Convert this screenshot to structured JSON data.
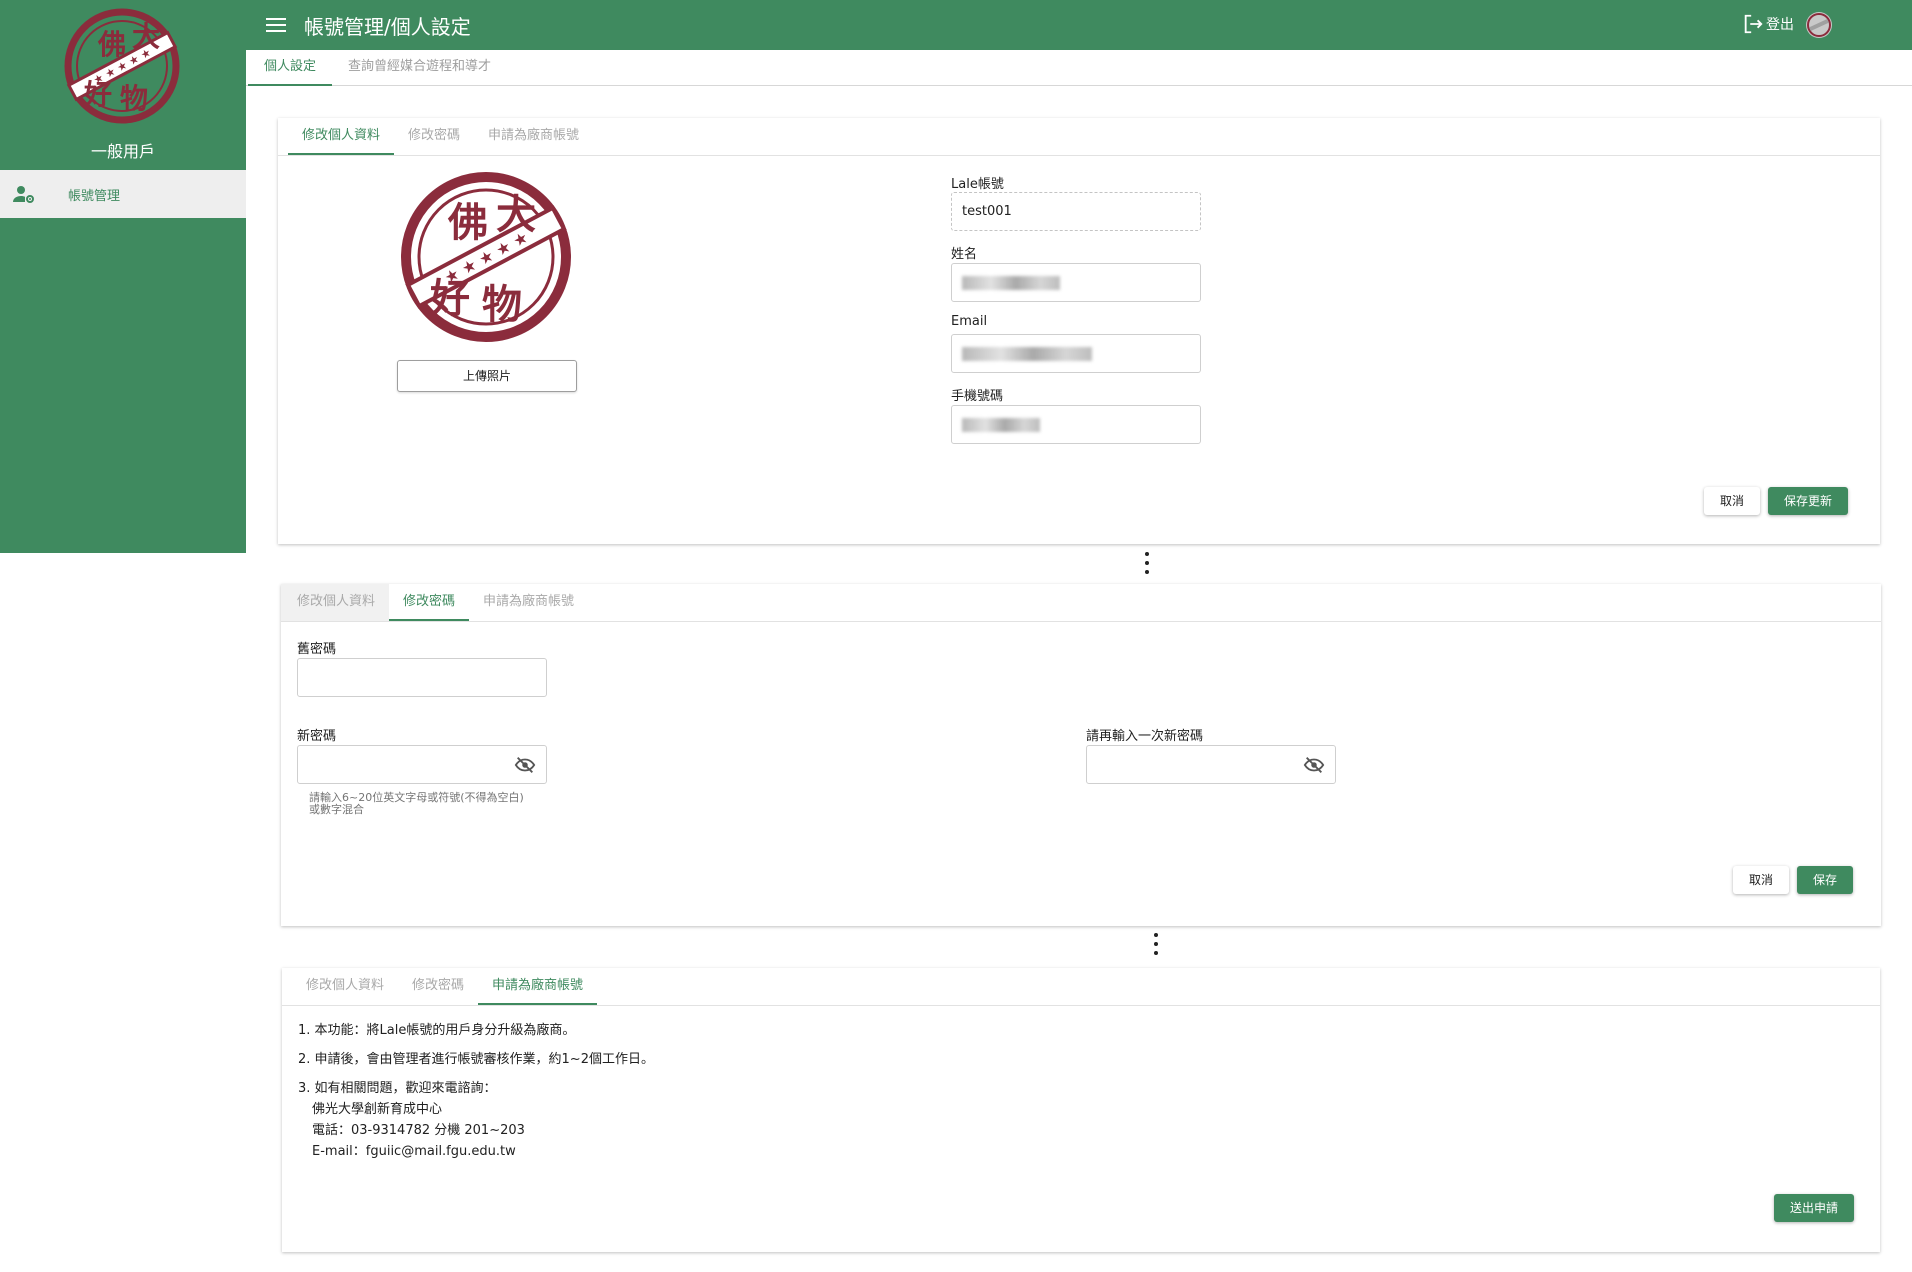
{
  "sidebar": {
    "role": "一般用戶",
    "logo_chars": [
      "佛",
      "大",
      "好",
      "物"
    ],
    "items": [
      {
        "label": "帳號管理",
        "icon": "user-settings-icon"
      }
    ]
  },
  "header": {
    "title": "帳號管理/個人設定",
    "logout_label": "登出",
    "menu_icon": "hamburger-menu-icon",
    "logout_icon": "logout-icon"
  },
  "page_tabs": [
    {
      "label": "個人設定",
      "active": true
    },
    {
      "label": "查詢曾經媒合遊程和導才",
      "active": false
    }
  ],
  "card_tabs": [
    "修改個人資料",
    "修改密碼",
    "申請為廠商帳號"
  ],
  "profile": {
    "upload_label": "上傳照片",
    "account_label": "Lale帳號",
    "account_value": "test001",
    "name_label": "姓名",
    "email_label": "Email",
    "phone_label": "手機號碼",
    "cancel_label": "取消",
    "save_label": "保存更新"
  },
  "password": {
    "old_label": "舊密碼",
    "new_label": "新密碼",
    "confirm_label": "請再輸入一次新密碼",
    "hint": "請輸入6~20位英文字母或符號(不得為空白)或數字混合",
    "cancel_label": "取消",
    "save_label": "保存"
  },
  "vendor": {
    "line1": "1. 本功能：將Lale帳號的用戶身分升級為廠商。",
    "line2": "2. 申請後，會由管理者進行帳號審核作業，約1~2個工作日。",
    "line3": "3. 如有相關問題，歡迎來電諮詢：",
    "contact_org": "佛光大學創新育成中心",
    "contact_phone": "電話：03-9314782 分機 201~203",
    "contact_email": "E-mail：fguiic@mail.fgu.edu.tw",
    "submit_label": "送出申請"
  },
  "colors": {
    "brand": "#3f8a5f",
    "seal": "#8b2c3c"
  }
}
